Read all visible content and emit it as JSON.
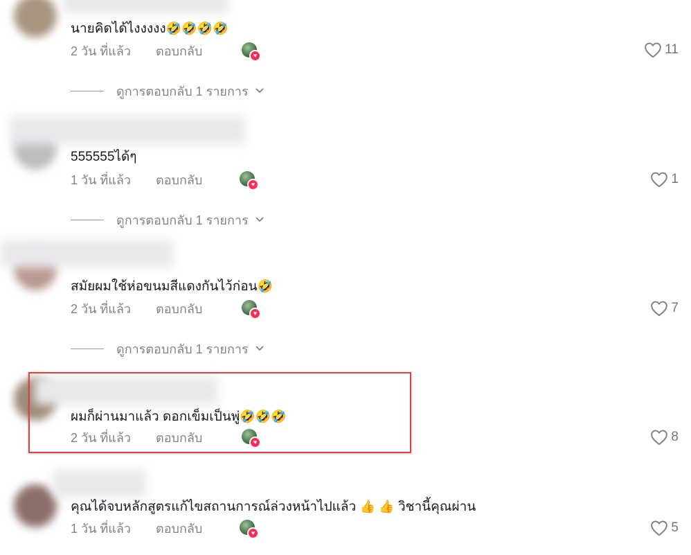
{
  "colors": {
    "accent": "#fe2c55",
    "text_primary": "#161823",
    "text_secondary": "#8a8b91",
    "annotation_box": "#e04040"
  },
  "comments": [
    {
      "text": "นายคิดได้ไงงงงง",
      "emoji": [
        "🤣",
        "🤣",
        "🤣",
        "🤣"
      ],
      "time": "2 วัน ที่แล้ว",
      "reply_label": "ตอบกลับ",
      "likes": "11",
      "view_replies": "ดูการตอบกลับ 1 รายการ",
      "avatar_color": "#a89580"
    },
    {
      "text": "555555ได้ๆ",
      "emoji": [],
      "time": "1 วัน ที่แล้ว",
      "reply_label": "ตอบกลับ",
      "likes": "1",
      "view_replies": "ดูการตอบกลับ 1 รายการ",
      "avatar_color": "#bdbdbd"
    },
    {
      "text": "สมัยผมใช้ห่อขนมสีแดงกันไว้ก่อน",
      "emoji": [
        "🤣"
      ],
      "time": "2 วัน ที่แล้ว",
      "reply_label": "ตอบกลับ",
      "likes": "7",
      "view_replies": "ดูการตอบกลับ 1 รายการ",
      "avatar_color": "#b89a90"
    },
    {
      "text": "ผมก็ผ่านมาแล้ว ดอกเข็มเป็นพู่",
      "emoji": [
        "🤣",
        "🤣",
        "🤣"
      ],
      "time": "2 วัน ที่แล้ว",
      "reply_label": "ตอบกลับ",
      "likes": "8",
      "avatar_color": "#9e8c7a"
    },
    {
      "text": "คุณได้จบหลักสูตรแก้ไขสถานการณ์ล่วงหน้าไปแล้ว",
      "emoji_mid": [
        "👍",
        "👍"
      ],
      "text_after": "วิชานี้คุณผ่าน",
      "time": "1 วัน ที่แล้ว",
      "reply_label": "ตอบกลับ",
      "likes": "5",
      "avatar_color": "#8c6f6a"
    }
  ]
}
